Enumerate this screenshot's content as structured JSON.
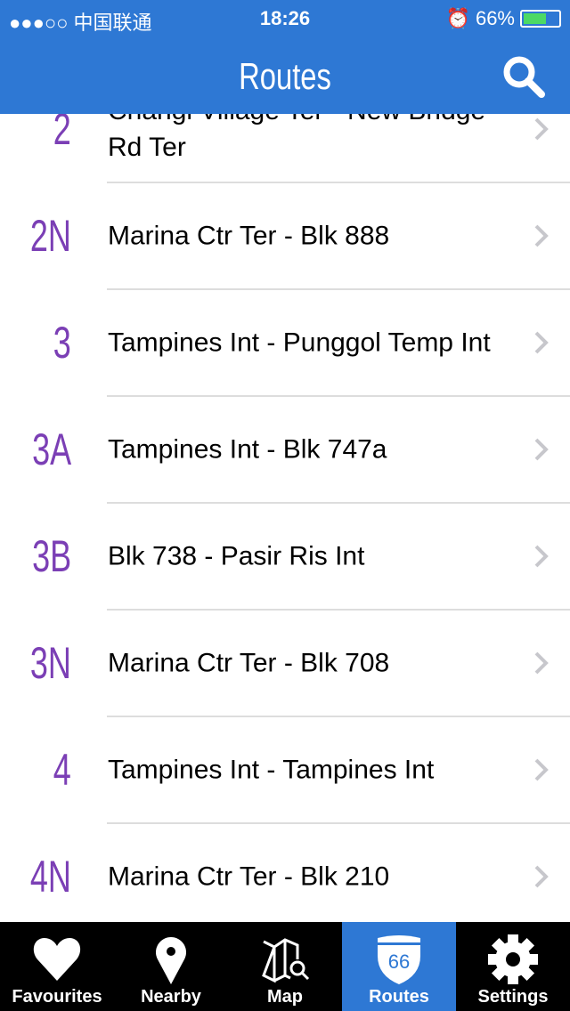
{
  "status": {
    "carrier": "●●●○○ 中国联通",
    "time": "18:26",
    "battery": "66%",
    "battery_level": 0.66
  },
  "nav": {
    "title": "Routes"
  },
  "routes": [
    {
      "number": "2",
      "name": "Changi Village Ter - New Bridge Rd Ter"
    },
    {
      "number": "2N",
      "name": "Marina Ctr Ter - Blk 888"
    },
    {
      "number": "3",
      "name": "Tampines Int - Punggol Temp Int"
    },
    {
      "number": "3A",
      "name": "Tampines Int - Blk 747a"
    },
    {
      "number": "3B",
      "name": "Blk 738 - Pasir Ris Int"
    },
    {
      "number": "3N",
      "name": "Marina Ctr Ter - Blk 708"
    },
    {
      "number": "4",
      "name": "Tampines Int - Tampines Int"
    },
    {
      "number": "4N",
      "name": "Marina Ctr Ter - Blk 210"
    }
  ],
  "tabs": [
    {
      "label": "Favourites",
      "icon": "heart-icon"
    },
    {
      "label": "Nearby",
      "icon": "map-pin-icon"
    },
    {
      "label": "Map",
      "icon": "map-search-icon"
    },
    {
      "label": "Routes",
      "icon": "interstate-66-icon",
      "badge": "66",
      "active": true
    },
    {
      "label": "Settings",
      "icon": "gear-icon"
    }
  ],
  "colors": {
    "accent": "#2e78d4",
    "route_number": "#7b3fb5"
  }
}
